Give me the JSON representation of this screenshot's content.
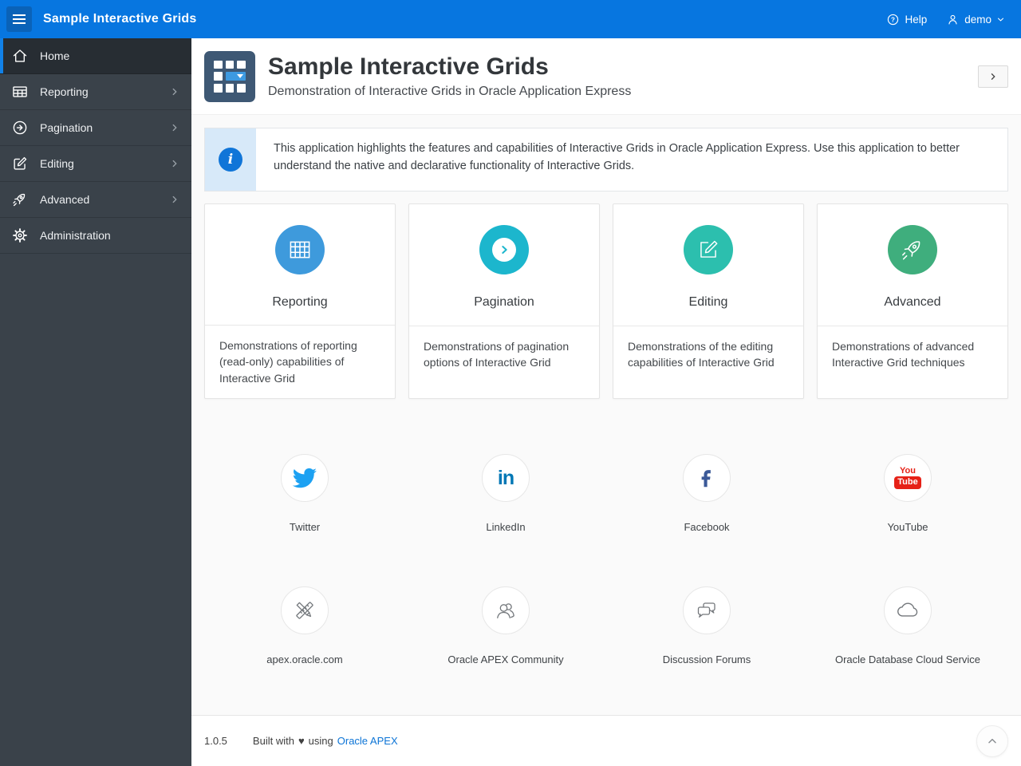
{
  "topbar": {
    "app_title": "Sample Interactive Grids",
    "help_label": "Help",
    "user_label": "demo",
    "help_glyph": "?",
    "header_color": "#0776e0"
  },
  "sidebar": {
    "items": [
      {
        "label": "Home",
        "icon": "home-icon",
        "active": true,
        "has_submenu": false
      },
      {
        "label": "Reporting",
        "icon": "table-icon",
        "active": false,
        "has_submenu": true
      },
      {
        "label": "Pagination",
        "icon": "arrow-circle-icon",
        "active": false,
        "has_submenu": true
      },
      {
        "label": "Editing",
        "icon": "edit-icon",
        "active": false,
        "has_submenu": true
      },
      {
        "label": "Advanced",
        "icon": "rocket-icon",
        "active": false,
        "has_submenu": true
      },
      {
        "label": "Administration",
        "icon": "gear-icon",
        "active": false,
        "has_submenu": false
      }
    ]
  },
  "page_header": {
    "title": "Sample Interactive Grids",
    "subtitle": "Demonstration of Interactive Grids in Oracle Application Express"
  },
  "info_box": {
    "glyph": "i",
    "text": "This application highlights the features and capabilities of Interactive Grids in Oracle Application Express. Use this application to better understand the native and declarative functionality of Interactive Grids."
  },
  "cards": [
    {
      "title": "Reporting",
      "description": "Demonstrations of reporting (read-only) capabilities of Interactive Grid",
      "color": "#3e9adc",
      "icon": "table-icon"
    },
    {
      "title": "Pagination",
      "description": "Demonstrations of pagination options of Interactive Grid",
      "color": "#1cb6cd",
      "icon": "arrow-circle-icon"
    },
    {
      "title": "Editing",
      "description": "Demonstrations of the editing capabilities of Interactive Grid",
      "color": "#2cbfae",
      "icon": "edit-icon"
    },
    {
      "title": "Advanced",
      "description": "Demonstrations of advanced Interactive Grid techniques",
      "color": "#3fae7d",
      "icon": "rocket-icon"
    }
  ],
  "links": {
    "row1": [
      {
        "label": "Twitter",
        "icon": "twitter-icon",
        "color": "#1da1f2"
      },
      {
        "label": "LinkedIn",
        "icon": "linkedin-icon",
        "color": "#0077b5",
        "logo": "in"
      },
      {
        "label": "Facebook",
        "icon": "facebook-icon",
        "color": "#3b5998"
      },
      {
        "label": "YouTube",
        "icon": "youtube-icon",
        "color": "#e62117",
        "logo_top": "You",
        "logo_bottom": "Tube"
      }
    ],
    "row2": [
      {
        "label": "apex.oracle.com",
        "icon": "pencil-ruler-icon"
      },
      {
        "label": "Oracle APEX Community",
        "icon": "people-icon"
      },
      {
        "label": "Discussion Forums",
        "icon": "chat-bubbles-icon"
      },
      {
        "label": "Oracle Database Cloud Service",
        "icon": "cloud-icon"
      }
    ]
  },
  "footer": {
    "version": "1.0.5",
    "built_with": "Built with",
    "heart": "♥",
    "using": "using",
    "link_label": "Oracle APEX"
  }
}
